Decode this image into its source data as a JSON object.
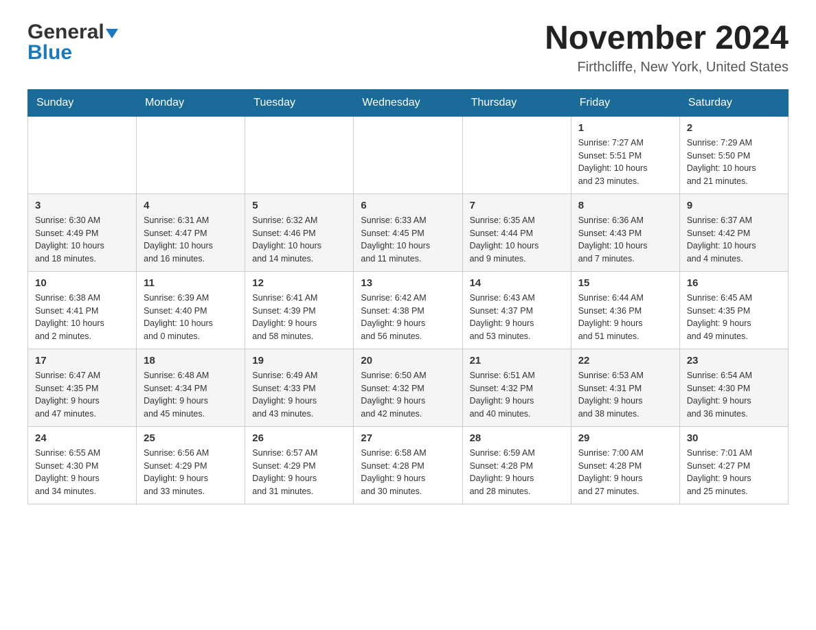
{
  "header": {
    "logo_general": "General",
    "logo_blue": "Blue",
    "month_year": "November 2024",
    "location": "Firthcliffe, New York, United States"
  },
  "days_of_week": [
    "Sunday",
    "Monday",
    "Tuesday",
    "Wednesday",
    "Thursday",
    "Friday",
    "Saturday"
  ],
  "weeks": [
    [
      {
        "day": "",
        "info": ""
      },
      {
        "day": "",
        "info": ""
      },
      {
        "day": "",
        "info": ""
      },
      {
        "day": "",
        "info": ""
      },
      {
        "day": "",
        "info": ""
      },
      {
        "day": "1",
        "info": "Sunrise: 7:27 AM\nSunset: 5:51 PM\nDaylight: 10 hours\nand 23 minutes."
      },
      {
        "day": "2",
        "info": "Sunrise: 7:29 AM\nSunset: 5:50 PM\nDaylight: 10 hours\nand 21 minutes."
      }
    ],
    [
      {
        "day": "3",
        "info": "Sunrise: 6:30 AM\nSunset: 4:49 PM\nDaylight: 10 hours\nand 18 minutes."
      },
      {
        "day": "4",
        "info": "Sunrise: 6:31 AM\nSunset: 4:47 PM\nDaylight: 10 hours\nand 16 minutes."
      },
      {
        "day": "5",
        "info": "Sunrise: 6:32 AM\nSunset: 4:46 PM\nDaylight: 10 hours\nand 14 minutes."
      },
      {
        "day": "6",
        "info": "Sunrise: 6:33 AM\nSunset: 4:45 PM\nDaylight: 10 hours\nand 11 minutes."
      },
      {
        "day": "7",
        "info": "Sunrise: 6:35 AM\nSunset: 4:44 PM\nDaylight: 10 hours\nand 9 minutes."
      },
      {
        "day": "8",
        "info": "Sunrise: 6:36 AM\nSunset: 4:43 PM\nDaylight: 10 hours\nand 7 minutes."
      },
      {
        "day": "9",
        "info": "Sunrise: 6:37 AM\nSunset: 4:42 PM\nDaylight: 10 hours\nand 4 minutes."
      }
    ],
    [
      {
        "day": "10",
        "info": "Sunrise: 6:38 AM\nSunset: 4:41 PM\nDaylight: 10 hours\nand 2 minutes."
      },
      {
        "day": "11",
        "info": "Sunrise: 6:39 AM\nSunset: 4:40 PM\nDaylight: 10 hours\nand 0 minutes."
      },
      {
        "day": "12",
        "info": "Sunrise: 6:41 AM\nSunset: 4:39 PM\nDaylight: 9 hours\nand 58 minutes."
      },
      {
        "day": "13",
        "info": "Sunrise: 6:42 AM\nSunset: 4:38 PM\nDaylight: 9 hours\nand 56 minutes."
      },
      {
        "day": "14",
        "info": "Sunrise: 6:43 AM\nSunset: 4:37 PM\nDaylight: 9 hours\nand 53 minutes."
      },
      {
        "day": "15",
        "info": "Sunrise: 6:44 AM\nSunset: 4:36 PM\nDaylight: 9 hours\nand 51 minutes."
      },
      {
        "day": "16",
        "info": "Sunrise: 6:45 AM\nSunset: 4:35 PM\nDaylight: 9 hours\nand 49 minutes."
      }
    ],
    [
      {
        "day": "17",
        "info": "Sunrise: 6:47 AM\nSunset: 4:35 PM\nDaylight: 9 hours\nand 47 minutes."
      },
      {
        "day": "18",
        "info": "Sunrise: 6:48 AM\nSunset: 4:34 PM\nDaylight: 9 hours\nand 45 minutes."
      },
      {
        "day": "19",
        "info": "Sunrise: 6:49 AM\nSunset: 4:33 PM\nDaylight: 9 hours\nand 43 minutes."
      },
      {
        "day": "20",
        "info": "Sunrise: 6:50 AM\nSunset: 4:32 PM\nDaylight: 9 hours\nand 42 minutes."
      },
      {
        "day": "21",
        "info": "Sunrise: 6:51 AM\nSunset: 4:32 PM\nDaylight: 9 hours\nand 40 minutes."
      },
      {
        "day": "22",
        "info": "Sunrise: 6:53 AM\nSunset: 4:31 PM\nDaylight: 9 hours\nand 38 minutes."
      },
      {
        "day": "23",
        "info": "Sunrise: 6:54 AM\nSunset: 4:30 PM\nDaylight: 9 hours\nand 36 minutes."
      }
    ],
    [
      {
        "day": "24",
        "info": "Sunrise: 6:55 AM\nSunset: 4:30 PM\nDaylight: 9 hours\nand 34 minutes."
      },
      {
        "day": "25",
        "info": "Sunrise: 6:56 AM\nSunset: 4:29 PM\nDaylight: 9 hours\nand 33 minutes."
      },
      {
        "day": "26",
        "info": "Sunrise: 6:57 AM\nSunset: 4:29 PM\nDaylight: 9 hours\nand 31 minutes."
      },
      {
        "day": "27",
        "info": "Sunrise: 6:58 AM\nSunset: 4:28 PM\nDaylight: 9 hours\nand 30 minutes."
      },
      {
        "day": "28",
        "info": "Sunrise: 6:59 AM\nSunset: 4:28 PM\nDaylight: 9 hours\nand 28 minutes."
      },
      {
        "day": "29",
        "info": "Sunrise: 7:00 AM\nSunset: 4:28 PM\nDaylight: 9 hours\nand 27 minutes."
      },
      {
        "day": "30",
        "info": "Sunrise: 7:01 AM\nSunset: 4:27 PM\nDaylight: 9 hours\nand 25 minutes."
      }
    ]
  ]
}
